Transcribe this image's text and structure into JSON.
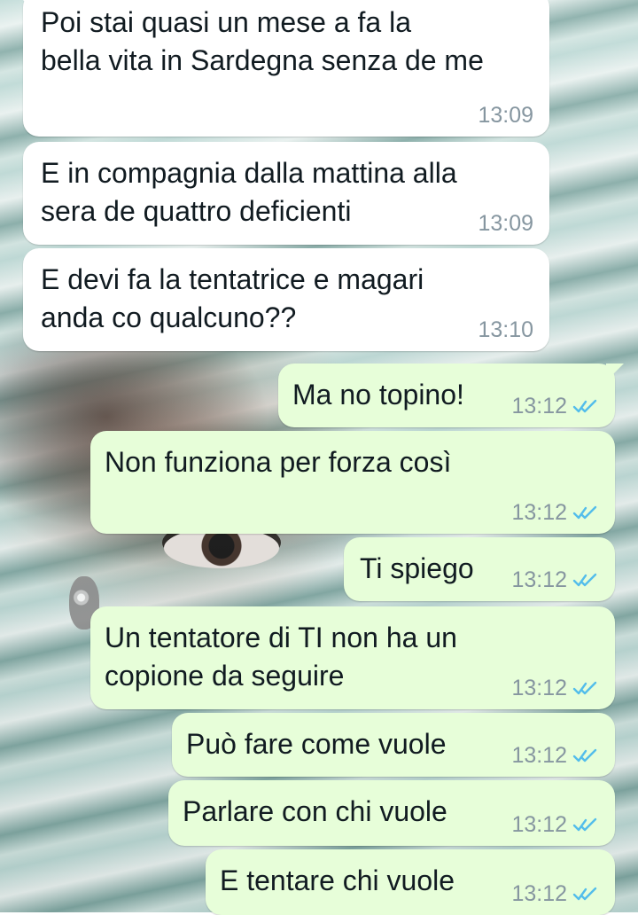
{
  "conversation": {
    "messages": [
      {
        "direction": "incoming",
        "text_lines": [
          "Poi stai quasi un mese a fa la",
          "bella vita in Sardegna senza de me"
        ],
        "time": "13:09"
      },
      {
        "direction": "incoming",
        "text_lines": [
          "E in compagnia dalla mattina alla",
          "sera de quattro deficienti"
        ],
        "time": "13:09"
      },
      {
        "direction": "incoming",
        "text_lines": [
          "E devi fa la tentatrice e magari",
          "anda co qualcuno??"
        ],
        "time": "13:10"
      },
      {
        "direction": "outgoing",
        "text_lines": [
          "Ma no topino!"
        ],
        "time": "13:12",
        "status": "read"
      },
      {
        "direction": "outgoing",
        "text_lines": [
          "Non funziona per forza così"
        ],
        "time": "13:12",
        "status": "read"
      },
      {
        "direction": "outgoing",
        "text_lines": [
          "Ti spiego"
        ],
        "time": "13:12",
        "status": "read"
      },
      {
        "direction": "outgoing",
        "text_lines": [
          "Un tentatore di TI non ha un",
          "copione da seguire"
        ],
        "time": "13:12",
        "status": "read"
      },
      {
        "direction": "outgoing",
        "text_lines": [
          "Può fare come vuole"
        ],
        "time": "13:12",
        "status": "read"
      },
      {
        "direction": "outgoing",
        "text_lines": [
          "Parlare con chi vuole"
        ],
        "time": "13:12",
        "status": "read"
      },
      {
        "direction": "outgoing",
        "text_lines": [
          "E tentare chi vuole"
        ],
        "time": "13:12",
        "status": "read"
      }
    ]
  },
  "colors": {
    "incoming_bubble": "#ffffff",
    "outgoing_bubble": "#e7fed9",
    "message_text": "#111b21",
    "timestamp": "#8696a0",
    "read_ticks": "#53bdeb"
  },
  "icons": {
    "read_receipt": "double-check-icon"
  }
}
